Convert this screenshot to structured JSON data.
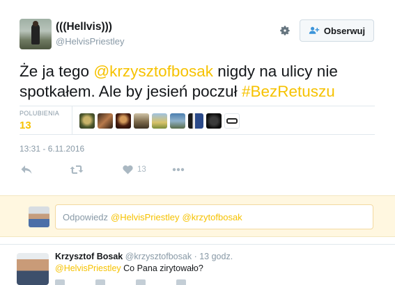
{
  "tweet": {
    "author_name": "(((Hellvis)))",
    "author_handle": "@HelvisPriestley",
    "follow_label": "Obserwuj",
    "text_part1": "Że ja tego ",
    "mention": "@krzysztofbosak",
    "text_part2": " nigdy na ulicy nie spotkałem. Ale by jesień poczuł ",
    "hashtag": "#BezRetuszu",
    "likes_label": "POLUBIENIA",
    "likes_count": "13",
    "timestamp": "13:31 - 6.11.2016",
    "action_like_count": "13"
  },
  "reply_box": {
    "prefix": "Odpowiedz",
    "mention1": "@HelvisPriestley",
    "mention2": "@krzytofbosak"
  },
  "reply": {
    "name": "Krzysztof Bosak",
    "handle": "@krzysztofbosak",
    "time": "· 13 godz.",
    "mention": "@HelvisPriestley",
    "text": " Co Pana zirytowało?"
  },
  "colors": {
    "accent": "#f6c200",
    "muted": "#8899a6",
    "reply_bg": "#fff7e0"
  },
  "icons": [
    "gear-icon",
    "follow-person-icon",
    "reply-icon",
    "retweet-icon",
    "heart-icon",
    "more-icon"
  ]
}
